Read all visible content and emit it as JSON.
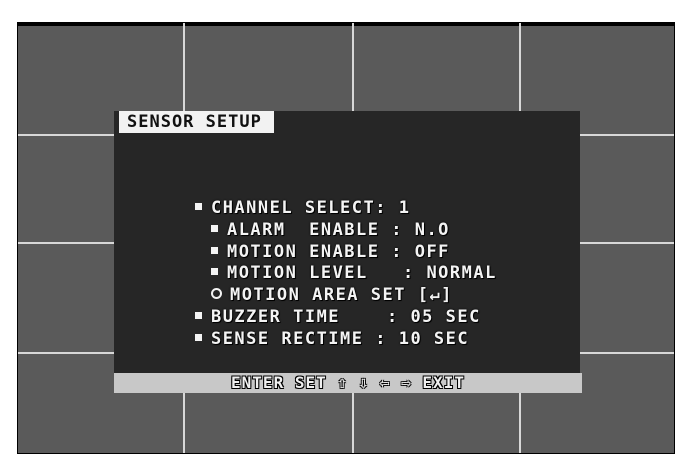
{
  "osd": {
    "title": "SENSOR SETUP",
    "items": [
      {
        "text": "CHANNEL SELECT: 1",
        "marker": "square"
      },
      {
        "text": "ALARM  ENABLE : N.O",
        "marker": "square"
      },
      {
        "text": "MOTION ENABLE : OFF",
        "marker": "square"
      },
      {
        "text": "MOTION LEVEL   : NORMAL",
        "marker": "square"
      },
      {
        "text": "MOTION AREA SET [↵]",
        "marker": "ring"
      },
      {
        "text": "BUZZER TIME    : 05 SEC",
        "marker": "square"
      },
      {
        "text": "SENSE RECTIME : 10 SEC",
        "marker": "square"
      }
    ],
    "footer": "ENTER SET ⇧ ⇩ ⇦ ⇨ EXIT"
  },
  "colors": {
    "grid_cell": "#5a5a5a",
    "grid_line": "#d8d8d8",
    "panel": "#262626",
    "title_bg": "#f2f2f2",
    "footer_bg": "#c8c8c8",
    "text": "#f4f4f4"
  }
}
